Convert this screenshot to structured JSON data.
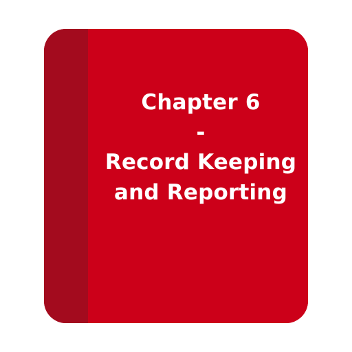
{
  "book": {
    "colors": {
      "cover": "#cc0019",
      "spine": "#a30b1e",
      "text": "#ffffff",
      "background": "#ffffff"
    },
    "title_lines": [
      "Chapter 6",
      "-",
      "Record Keeping",
      "and Reporting"
    ]
  }
}
